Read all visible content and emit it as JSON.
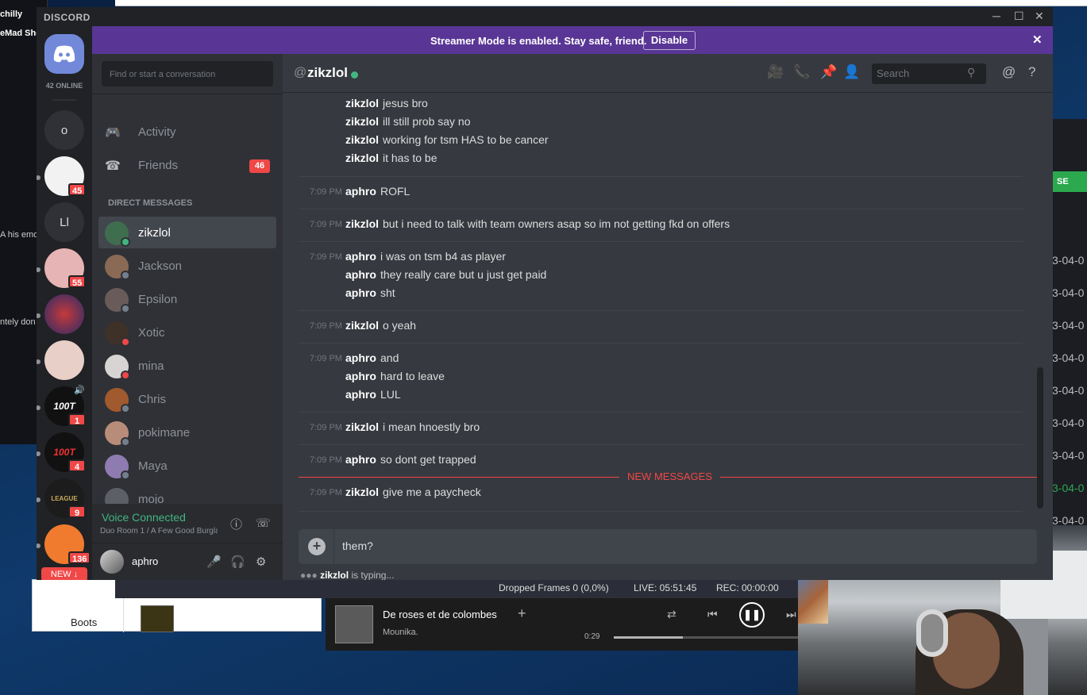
{
  "background_windows": {
    "left_top": "chilly",
    "left_sub": "eMad She",
    "left_text_1": "A his emo",
    "left_text_2": "ntely don",
    "below_label": "Boots",
    "right_button": "SE",
    "right_dates": [
      "3-04-0",
      "3-04-0",
      "3-04-0",
      "3-04-0",
      "3-04-0",
      "3-04-0",
      "3-04-0",
      "3-04-0",
      "3-04-0"
    ]
  },
  "discord": {
    "app_title": "DISCORD",
    "online_count": "42 ONLINE",
    "streamer_banner": {
      "message": "Streamer Mode is enabled. Stay safe, friend.",
      "button": "Disable"
    },
    "guilds": [
      {
        "label": "o",
        "badge": ""
      },
      {
        "label": "",
        "badge": "45"
      },
      {
        "label": "Ll",
        "badge": ""
      },
      {
        "label": "",
        "badge": "55"
      },
      {
        "label": "",
        "badge": ""
      },
      {
        "label": "",
        "badge": ""
      },
      {
        "label": "",
        "badge": "1"
      },
      {
        "label": "",
        "badge": "4"
      },
      {
        "label": "",
        "badge": "9"
      },
      {
        "label": "",
        "badge": "136"
      }
    ],
    "new_pill": "NEW ↓",
    "search_placeholder": "Find or start a conversation",
    "nav": {
      "activity": "Activity",
      "friends": "Friends",
      "friends_badge": "46"
    },
    "dm_header": "DIRECT MESSAGES",
    "dms": [
      {
        "name": "zikzlol",
        "status": "#43b581",
        "avatar": "#3f6e4f"
      },
      {
        "name": "Jackson",
        "status": "#747f8d",
        "avatar": "#8a6a55"
      },
      {
        "name": "Epsilon",
        "status": "#747f8d",
        "avatar": "#6a5b5b"
      },
      {
        "name": "Xotic",
        "status": "#f04747",
        "avatar": "#3d3128"
      },
      {
        "name": "mina",
        "status": "#f04747",
        "avatar": "#d9d4d4"
      },
      {
        "name": "Chris",
        "status": "#747f8d",
        "avatar": "#a05a2e"
      },
      {
        "name": "pokimane",
        "status": "#747f8d",
        "avatar": "#b78d7a"
      },
      {
        "name": "Maya",
        "status": "#747f8d",
        "avatar": "#8e7cb0"
      },
      {
        "name": "mojo",
        "status": "#747f8d",
        "avatar": "#5c5f66"
      }
    ],
    "voice": {
      "status": "Voice Connected",
      "room": "Duo Room 1 / A Few Good Burgla..."
    },
    "user": {
      "name": "aphro"
    },
    "chat_header": {
      "at": "@",
      "name": "zikzlol",
      "search_placeholder": "Search"
    },
    "message_groups": [
      {
        "time": "",
        "lines": [
          {
            "author": "zikzlol",
            "text": "jesus bro"
          },
          {
            "author": "zikzlol",
            "text": "ill still prob say no"
          },
          {
            "author": "zikzlol",
            "text": "working for tsm HAS to be cancer"
          },
          {
            "author": "zikzlol",
            "text": "it has to be"
          }
        ]
      },
      {
        "time": "7:09 PM",
        "lines": [
          {
            "author": "aphro",
            "text": "ROFL"
          }
        ]
      },
      {
        "time": "7:09 PM",
        "lines": [
          {
            "author": "zikzlol",
            "text": "but i need to talk with team owners asap so im not getting fkd on offers"
          }
        ]
      },
      {
        "time": "7:09 PM",
        "lines": [
          {
            "author": "aphro",
            "text": "i was on tsm b4 as player"
          },
          {
            "author": "aphro",
            "text": "they really care but u just get paid"
          },
          {
            "author": "aphro",
            "text": "sht"
          }
        ]
      },
      {
        "time": "7:09 PM",
        "lines": [
          {
            "author": "zikzlol",
            "text": "o yeah"
          }
        ]
      },
      {
        "time": "7:09 PM",
        "lines": [
          {
            "author": "aphro",
            "text": "and"
          },
          {
            "author": "aphro",
            "text": "hard to leave"
          },
          {
            "author": "aphro",
            "text": "LUL"
          }
        ]
      },
      {
        "time": "7:09 PM",
        "lines": [
          {
            "author": "zikzlol",
            "text": "i mean hnoestly bro"
          }
        ]
      },
      {
        "time": "7:09 PM",
        "lines": [
          {
            "author": "aphro",
            "text": "so dont get trapped"
          }
        ]
      },
      {
        "time": "7:09 PM",
        "lines": [
          {
            "author": "zikzlol",
            "text": "give me a paycheck"
          }
        ]
      }
    ],
    "new_messages_label": "NEW MESSAGES",
    "input_value": "them?",
    "typing": {
      "user": "zikzlol",
      "suffix": " is typing..."
    }
  },
  "obs": {
    "dropped": "Dropped Frames 0 (0,0%)",
    "live": "LIVE: 05:51:45",
    "rec": "REC: 00:00:00"
  },
  "player": {
    "title": "De roses et de colombes",
    "artist": "Mounika.",
    "elapsed": "0:29",
    "progress": 0.37
  }
}
